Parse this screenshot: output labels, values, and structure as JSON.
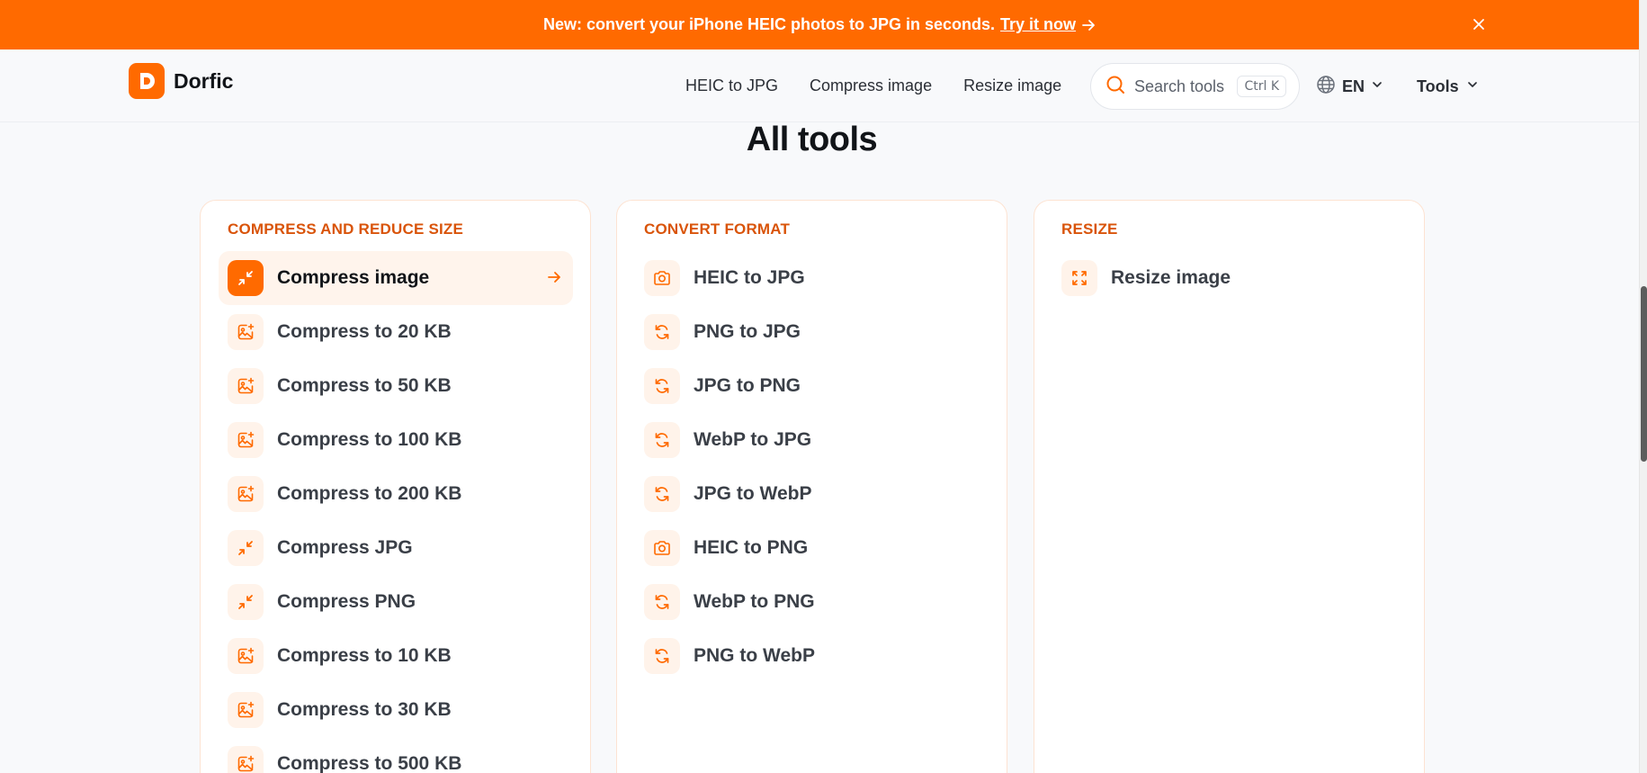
{
  "banner": {
    "text": "New: convert your iPhone HEIC photos to JPG in seconds.",
    "link": "Try it now"
  },
  "header": {
    "logo_text": "Dorfic",
    "nav": [
      "HEIC to JPG",
      "Compress image",
      "Resize image"
    ],
    "search_label": "Search tools",
    "search_shortcut": "Ctrl K",
    "language": "EN",
    "tools_label": "Tools"
  },
  "main": {
    "title": "All tools",
    "sections": [
      {
        "heading": "COMPRESS AND REDUCE SIZE",
        "items": [
          {
            "label": "Compress image",
            "icon": "compress-icon",
            "active": true
          },
          {
            "label": "Compress to 20 KB",
            "icon": "image-sparkle-icon"
          },
          {
            "label": "Compress to 50 KB",
            "icon": "image-sparkle-icon"
          },
          {
            "label": "Compress to 100 KB",
            "icon": "image-sparkle-icon"
          },
          {
            "label": "Compress to 200 KB",
            "icon": "image-sparkle-icon"
          },
          {
            "label": "Compress JPG",
            "icon": "compress-icon"
          },
          {
            "label": "Compress PNG",
            "icon": "compress-icon"
          },
          {
            "label": "Compress to 10 KB",
            "icon": "image-sparkle-icon"
          },
          {
            "label": "Compress to 30 KB",
            "icon": "image-sparkle-icon"
          },
          {
            "label": "Compress to 500 KB",
            "icon": "image-sparkle-icon"
          }
        ]
      },
      {
        "heading": "CONVERT FORMAT",
        "items": [
          {
            "label": "HEIC to JPG",
            "icon": "camera-icon"
          },
          {
            "label": "PNG to JPG",
            "icon": "refresh-icon"
          },
          {
            "label": "JPG to PNG",
            "icon": "refresh-icon"
          },
          {
            "label": "WebP to JPG",
            "icon": "refresh-icon"
          },
          {
            "label": "JPG to WebP",
            "icon": "refresh-icon"
          },
          {
            "label": "HEIC to PNG",
            "icon": "camera-icon"
          },
          {
            "label": "WebP to PNG",
            "icon": "refresh-icon"
          },
          {
            "label": "PNG to WebP",
            "icon": "refresh-icon"
          }
        ]
      },
      {
        "heading": "RESIZE",
        "items": [
          {
            "label": "Resize image",
            "icon": "expand-icon"
          }
        ]
      }
    ]
  },
  "colors": {
    "brand": "#ff6a00",
    "section_heading": "#d9540a",
    "icon_bg": "#fff3ea",
    "active_row_bg": "#fff4ec",
    "card_border": "#fde3d2"
  }
}
